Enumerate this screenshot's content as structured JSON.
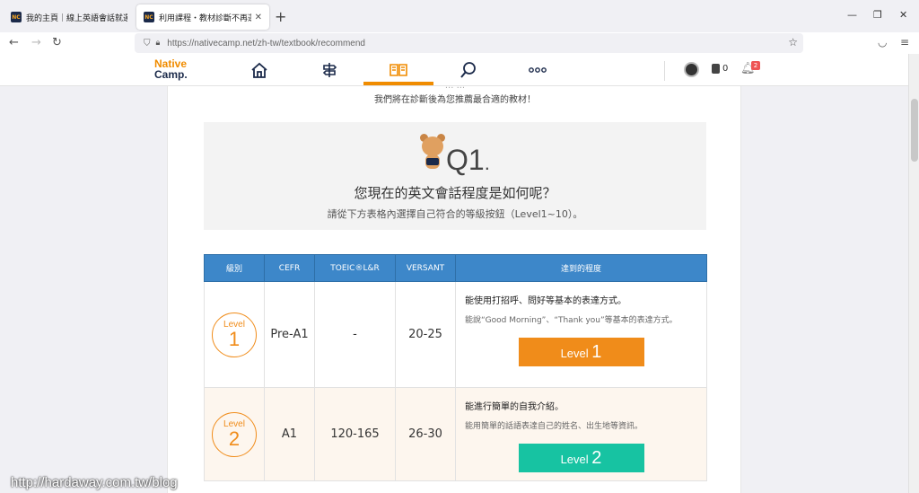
{
  "browser": {
    "tabs": [
      {
        "title": "我的主頁｜線上英語會話就選N",
        "favicon": "NC"
      },
      {
        "title": "利用課程・教材診斷不再選擇困",
        "favicon": "NC"
      }
    ],
    "url": "https://nativecamp.net/zh-tw/textbook/recommend"
  },
  "site": {
    "logo_line1": "Native",
    "logo_line2": "Camp.",
    "nav_icons": [
      "home-icon",
      "signpost-icon",
      "book-icon",
      "search-icon",
      "more-icon"
    ],
    "active_nav": "book-icon",
    "coins": "0",
    "notifications": "2"
  },
  "intro": {
    "cut_text": "... ...",
    "subtitle": "我們將在診斷後為您推薦最合適的教材！"
  },
  "question": {
    "number": "Q1",
    "dot": ".",
    "title": "您現在的英文會話程度是如何呢？",
    "subtitle": "請從下方表格內選擇自己符合的等級按鈕（Level1~10）。"
  },
  "table": {
    "headers": [
      "級別",
      "CEFR",
      "TOEIC®L&R",
      "VERSANT",
      "達到的程度"
    ],
    "rows": [
      {
        "level_word": "Level",
        "level_num": "1",
        "cefr": "Pre-A1",
        "toeic": "-",
        "versant": "20-25",
        "desc_head": "能使用打招呼、問好等基本的表達方式。",
        "desc_body": "能說“Good Morning”、“Thank you”等基本的表達方式。",
        "button_word": "Level",
        "button_num": "1",
        "button_color": "#f08c1a"
      },
      {
        "level_word": "Level",
        "level_num": "2",
        "cefr": "A1",
        "toeic": "120-165",
        "versant": "26-30",
        "desc_head": "能進行簡單的自我介紹。",
        "desc_body": "能用簡單的話語表達自己的姓名、出生地等資訊。",
        "button_word": "Level",
        "button_num": "2",
        "button_color": "#17c3a2"
      }
    ]
  },
  "watermark": "http://hardaway.com.tw/blog"
}
